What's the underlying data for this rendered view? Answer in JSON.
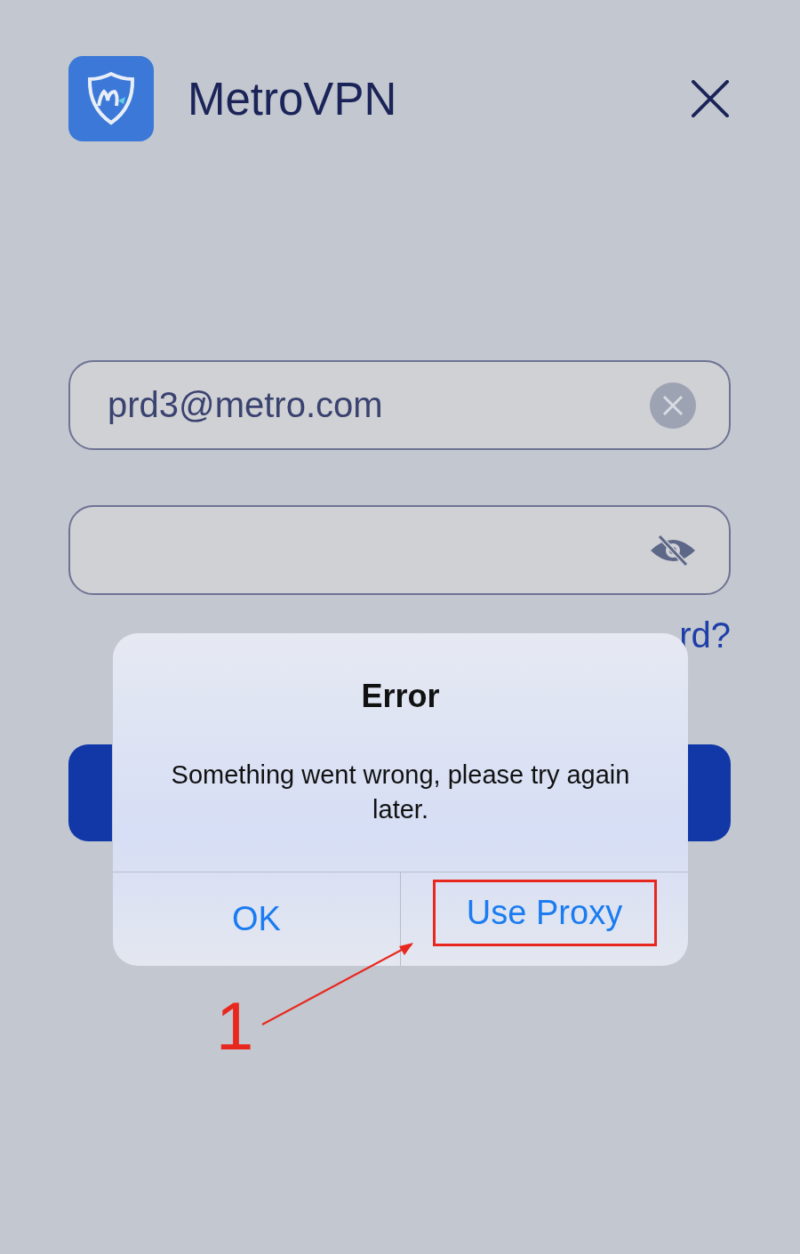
{
  "app": {
    "name": "MetroVPN"
  },
  "email_field": {
    "value": "prd3@metro.com"
  },
  "password_field": {
    "value_hidden": true
  },
  "forgot_link": {
    "label": "rd?"
  },
  "dialog": {
    "title": "Error",
    "message": "Something went wrong, please try again later.",
    "buttons": [
      {
        "label": "OK",
        "highlighted": false
      },
      {
        "label": "Use Proxy",
        "highlighted": true
      }
    ]
  },
  "annotation": {
    "label": "1"
  }
}
